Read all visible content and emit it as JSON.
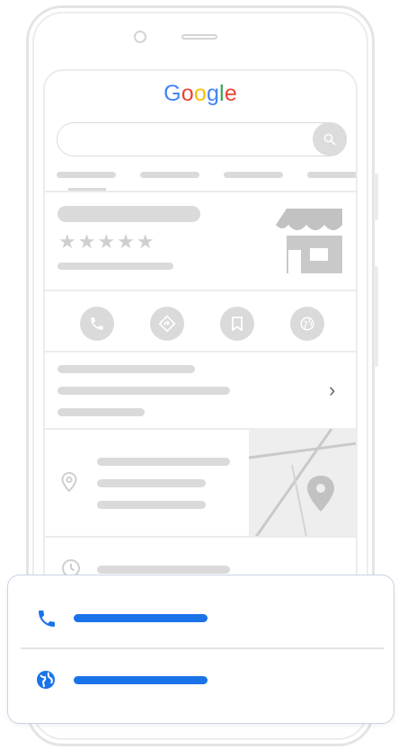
{
  "brand": {
    "logo_letters": [
      "G",
      "o",
      "o",
      "g",
      "l",
      "e"
    ],
    "logo_colors": [
      "#4285F4",
      "#EA4335",
      "#FBBC05",
      "#4285F4",
      "#34A853",
      "#EA4335"
    ]
  },
  "listing": {
    "rating_stars": "★★★★★",
    "more_chevron": "›"
  },
  "colors": {
    "accent": "#1a73e8",
    "placeholder": "#dadada",
    "frame": "#e4e4e4"
  },
  "icons": {
    "search": "search-icon",
    "phone": "phone-icon",
    "directions": "directions-icon",
    "save": "bookmark-icon",
    "website": "globe-icon",
    "location": "location-pin-icon",
    "hours": "clock-icon",
    "storefront": "storefront-icon"
  }
}
